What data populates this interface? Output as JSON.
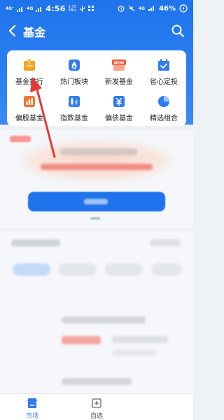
{
  "status_bar": {
    "signal_1": "4G⁺",
    "signal_2": "4G",
    "time": "4:56",
    "net_speed_value": "2.70",
    "net_speed_unit": "KB/s",
    "battery_percent": "46%",
    "right_signal": "4G"
  },
  "navbar": {
    "title": "基金"
  },
  "quick_menu": {
    "items": [
      {
        "label": "基金排行",
        "icon": "trophy-icon",
        "color": "#f4a623"
      },
      {
        "label": "热门板块",
        "icon": "flame-icon",
        "color": "#2f7bf0"
      },
      {
        "label": "新发基金",
        "icon": "new-badge-icon",
        "color": "#f55a3c",
        "badge": "NEW"
      },
      {
        "label": "省心定投",
        "icon": "calendar-check-icon",
        "color": "#2f7bf0"
      },
      {
        "label": "偏股基金",
        "icon": "bar-chart-icon",
        "color": "#f0742f"
      },
      {
        "label": "指数基金",
        "icon": "candlestick-icon",
        "color": "#2f7bf0"
      },
      {
        "label": "偏债基金",
        "icon": "bond-yen-icon",
        "color": "#2f7bf0"
      },
      {
        "label": "精选组合",
        "icon": "pie-chart-icon",
        "color": "#2f7bf0"
      }
    ]
  },
  "tabbar": {
    "tabs": [
      {
        "label": "市场",
        "icon": "market-icon",
        "active": true,
        "color": "#2f7bf0"
      },
      {
        "label": "自选",
        "icon": "add-watchlist-icon",
        "active": false,
        "color": "#666666"
      }
    ]
  },
  "colors": {
    "header_blue": "#1f73ec",
    "annotation_red": "#e53935"
  }
}
